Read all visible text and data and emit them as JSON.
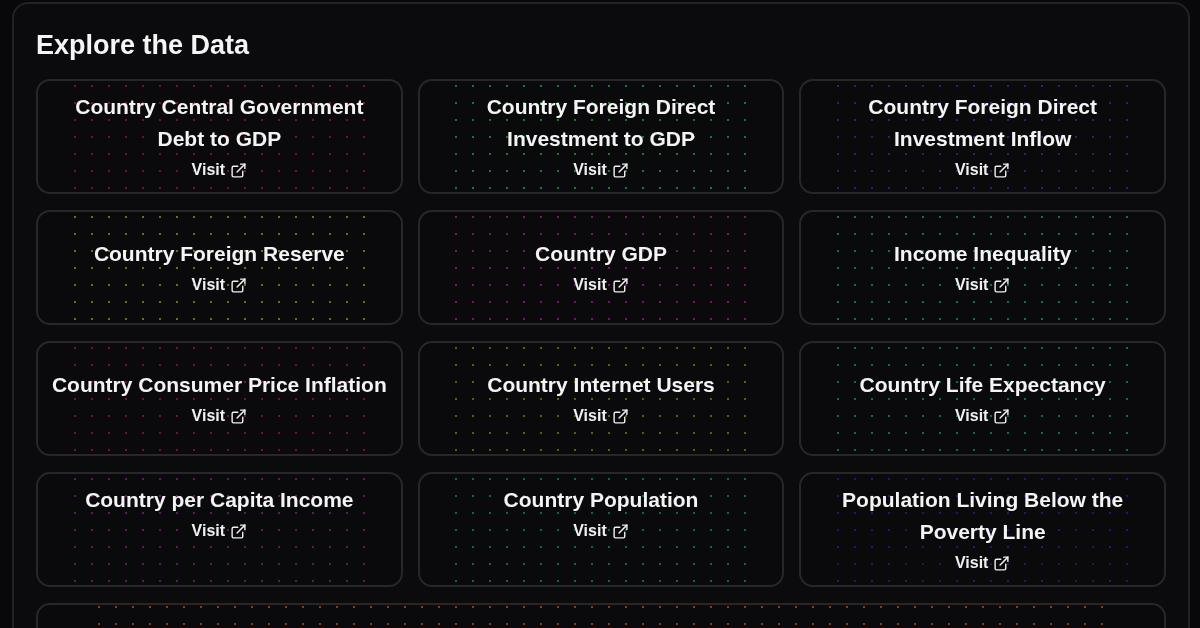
{
  "section": {
    "title": "Explore the Data"
  },
  "cards": [
    {
      "title": "Country Central Government Debt to GDP",
      "link": "Visit",
      "color": "#7a1414"
    },
    {
      "title": "Country Foreign Direct Investment to GDP",
      "link": "Visit",
      "color": "#1c7a24"
    },
    {
      "title": "Country Foreign Direct Investment Inflow",
      "link": "Visit",
      "color": "#1e2878"
    },
    {
      "title": "Country Foreign Reserve",
      "link": "Visit",
      "color": "#6e6e12"
    },
    {
      "title": "Country GDP",
      "link": "Visit",
      "color": "#7a127a"
    },
    {
      "title": "Income Inequality",
      "link": "Visit",
      "color": "#106e5e"
    },
    {
      "title": "Country Consumer Price Inflation",
      "link": "Visit",
      "color": "#6e1244"
    },
    {
      "title": "Country Internet Users",
      "link": "Visit",
      "color": "#5e5e14"
    },
    {
      "title": "Country Life Expectancy",
      "link": "Visit",
      "color": "#106e46"
    },
    {
      "title": "Country per Capita Income",
      "link": "Visit",
      "color": "#661266"
    },
    {
      "title": "Country Population",
      "link": "Visit",
      "color": "#105e5e"
    },
    {
      "title": "Population Living Below the Poverty Line",
      "link": "Visit",
      "color": "#1a1a6e"
    }
  ],
  "bottom_card": {
    "color": "#8a3a12"
  }
}
